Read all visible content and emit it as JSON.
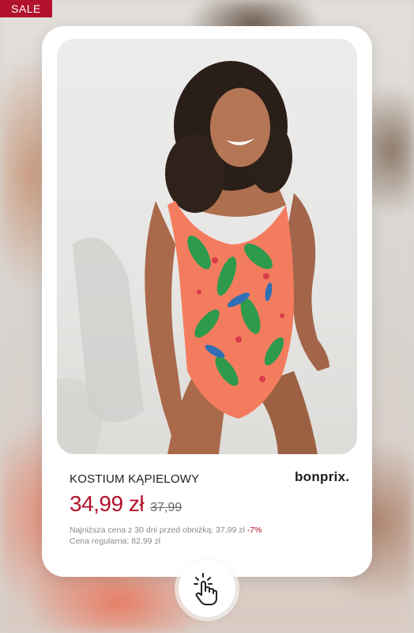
{
  "badge": {
    "label": "SALE"
  },
  "product": {
    "name": "KOSTIUM KĄPIELOWY",
    "brand": "bonprix.",
    "price": "34,99 zł",
    "old_price": "37,99",
    "lowest_price_note": "Najniższa cena z 30 dni przed obniżką: 37,99 zł",
    "discount": "-7%",
    "regular_price_note": "Cena regularna: 82,99 zł"
  },
  "icons": {
    "tap": "hand-pointer-icon"
  },
  "colors": {
    "accent": "#b2122b",
    "swimsuit": "#f47c5e"
  }
}
